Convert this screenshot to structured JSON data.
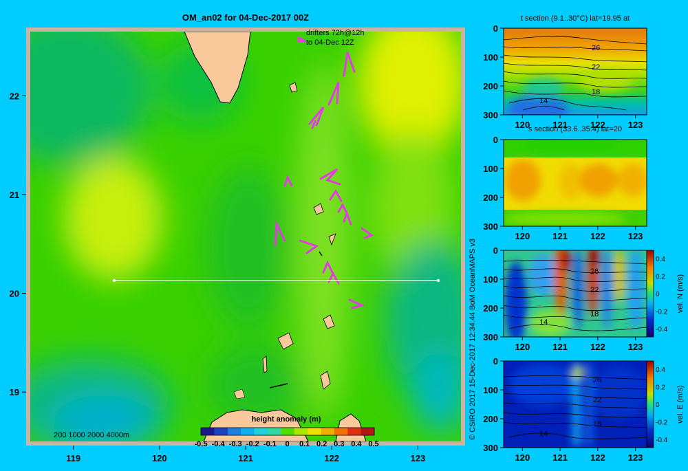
{
  "title": "OM_an02 for 04-Dec-2017 00Z",
  "credit": "© CSIRO 2017   15-Dec-2017 12:34:44 BoM OceanMAPS v3",
  "colors": {
    "background": "#00ccff",
    "land": "#f9c89b",
    "track": "#ffffff",
    "drifter": "#e23ce2"
  },
  "chart_data": [
    {
      "type": "heatmap",
      "name": "main-map",
      "title": "OM_an02 for 04-Dec-2017 00Z",
      "xlim": [
        118.5,
        123.5
      ],
      "ylim": [
        18.5,
        22.65
      ],
      "x_ticks": [
        "119",
        "120",
        "121",
        "122",
        "123"
      ],
      "y_ticks": [
        "19",
        "20",
        "21",
        "22"
      ],
      "annotations": [
        "drifters 72h@12h",
        "to 04-Dec 12Z"
      ],
      "depth_legend": "200  1000  2000  4000m",
      "section_line": {
        "lat": 20,
        "lon_start": 119.5,
        "lon_end": 123.2
      },
      "colorbar": {
        "title": "height anomaly  (m)",
        "range": [
          -0.5,
          0.5
        ],
        "tick_labels": [
          "-0.5",
          "-0.4",
          "-0.3",
          "-0.2",
          "-0.1",
          "0",
          "0.1",
          "0.2",
          "0.3",
          "0.4",
          "0.5"
        ]
      }
    },
    {
      "type": "heatmap",
      "name": "t-section",
      "title": "t section (9.1..30°C) lat=19.95 at",
      "xlim": [
        119.5,
        123.3
      ],
      "ylim": [
        300,
        0
      ],
      "x_ticks": [
        "120",
        "121",
        "122",
        "123"
      ],
      "y_ticks": [
        "0",
        "100",
        "200",
        "300"
      ],
      "contour_labels": [
        "26",
        "22",
        "18",
        "14"
      ]
    },
    {
      "type": "heatmap",
      "name": "s-section",
      "title": "s section (33.6..35.4) lat=20",
      "xlim": [
        119.5,
        123.3
      ],
      "ylim": [
        300,
        0
      ],
      "x_ticks": [
        "120",
        "121",
        "122",
        "123"
      ],
      "y_ticks": [
        "0",
        "100",
        "200",
        "300"
      ]
    },
    {
      "type": "heatmap",
      "name": "vel-n-section",
      "xlim": [
        119.5,
        123.3
      ],
      "ylim": [
        300,
        0
      ],
      "x_ticks": [
        "120",
        "121",
        "122",
        "123"
      ],
      "y_ticks": [
        "0",
        "100",
        "200",
        "300"
      ],
      "contour_labels": [
        "26",
        "22",
        "18",
        "14"
      ],
      "colorbar": {
        "label": "vel. N  (m/s)",
        "range": [
          -0.4,
          0.4
        ],
        "tick_labels": [
          "0.4",
          "0.2",
          "0",
          "-0.2",
          "-0.4"
        ]
      }
    },
    {
      "type": "heatmap",
      "name": "vel-e-section",
      "xlim": [
        119.5,
        123.3
      ],
      "ylim": [
        300,
        0
      ],
      "x_ticks": [
        "120",
        "121",
        "122",
        "123"
      ],
      "y_ticks": [
        "0",
        "100",
        "200",
        "300"
      ],
      "contour_labels": [
        "26",
        "22",
        "18",
        "14"
      ],
      "colorbar": {
        "label": "vel. E  (m/s)",
        "range": [
          -0.4,
          0.4
        ],
        "tick_labels": [
          "0.4",
          "0.2",
          "0",
          "-0.2",
          "-0.4"
        ]
      }
    }
  ]
}
